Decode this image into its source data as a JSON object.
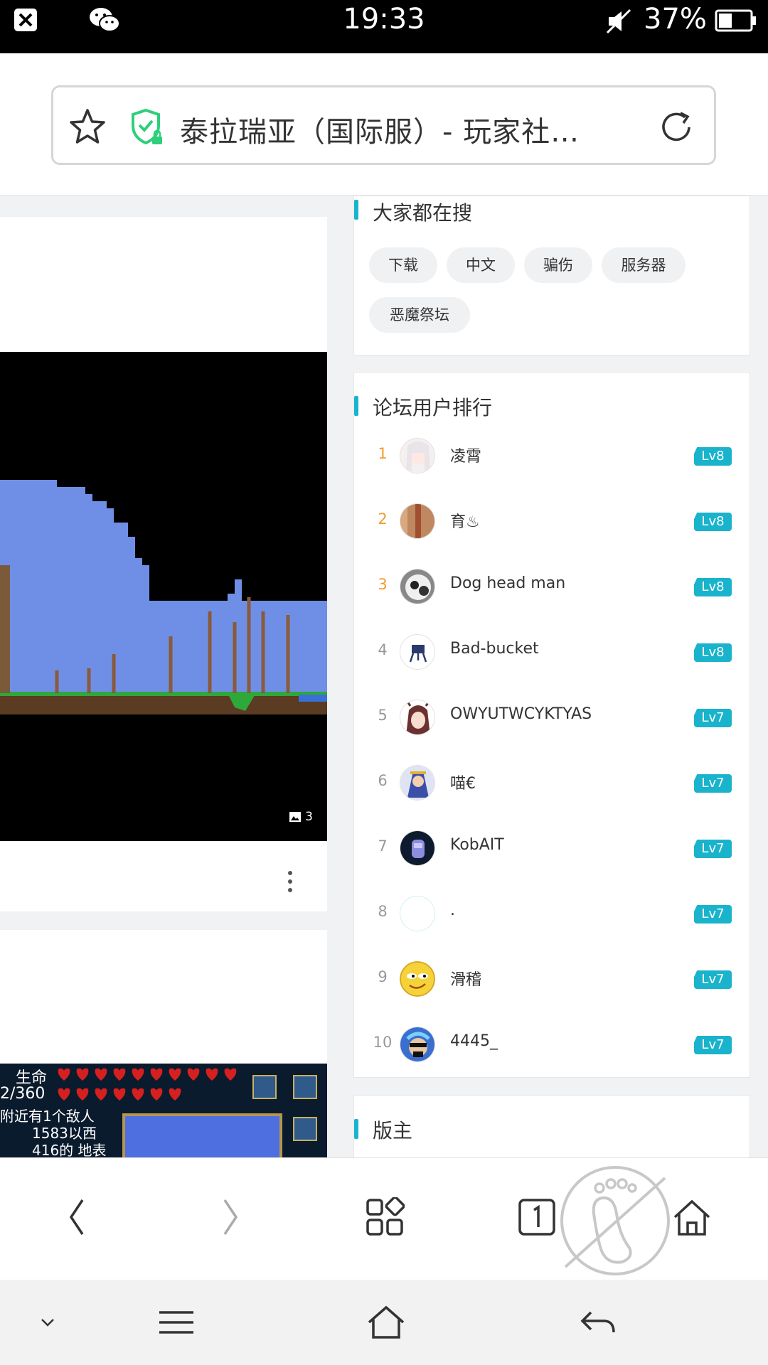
{
  "status_bar": {
    "time": "19:33",
    "battery": "37%"
  },
  "address_bar": {
    "title": "泰拉瑞亚（国际服）- 玩家社…"
  },
  "left_cards": {
    "image_count": "3",
    "hud_text": "生命",
    "hud_hp": "2/360",
    "hud_enemy": "附近有1个敌人",
    "hud_pos": "1583以西",
    "hud_depth": "416的 地表"
  },
  "search_section": {
    "title": "大家都在搜",
    "tags": [
      "下载",
      "中文",
      "骗伤",
      "服务器",
      "恶魔祭坛"
    ]
  },
  "rank_section": {
    "title": "论坛用户排行",
    "users": [
      {
        "rank": "1",
        "name": "凌霄",
        "level": "Lv8"
      },
      {
        "rank": "2",
        "name": "育♨",
        "level": "Lv8"
      },
      {
        "rank": "3",
        "name": "Dog head man",
        "level": "Lv8"
      },
      {
        "rank": "4",
        "name": "Bad-bucket",
        "level": "Lv8"
      },
      {
        "rank": "5",
        "name": "OWYUTWCYKTYAS",
        "level": "Lv7"
      },
      {
        "rank": "6",
        "name": "喵€",
        "level": "Lv7"
      },
      {
        "rank": "7",
        "name": "KobAIT",
        "level": "Lv7"
      },
      {
        "rank": "8",
        "name": ".",
        "level": "Lv7"
      },
      {
        "rank": "9",
        "name": "滑稽",
        "level": "Lv7"
      },
      {
        "rank": "10",
        "name": "4445_",
        "level": "Lv7"
      }
    ]
  },
  "moderator_section": {
    "title": "版主"
  },
  "colors": {
    "accent": "#1ab3cc",
    "rank_top": "#f39a2a"
  }
}
